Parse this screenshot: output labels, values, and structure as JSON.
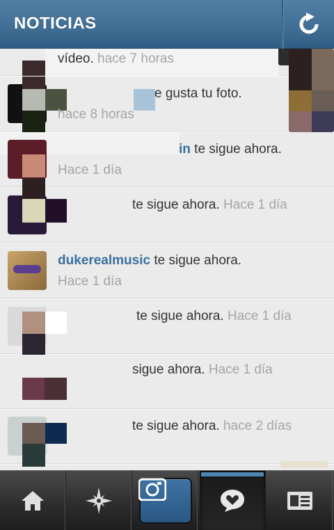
{
  "header": {
    "title": "NOTICIAS",
    "refresh_icon": "refresh-icon"
  },
  "notifications": [
    {
      "user": "",
      "action": "vídeo.",
      "time": "hace 7 horas"
    },
    {
      "user": "",
      "action": "e gusta tu foto.",
      "time": "hace 8 horas"
    },
    {
      "user": "in",
      "action": "te sigue ahora.",
      "time": "Hace 1 día"
    },
    {
      "user": "",
      "action": "te sigue ahora.",
      "time": "Hace 1 día"
    },
    {
      "user": "dukerealmusic",
      "action": "te sigue ahora.",
      "time": "Hace 1 día"
    },
    {
      "user": "",
      "action": "te sigue ahora.",
      "time": "Hace 1 día"
    },
    {
      "user": "",
      "action": "sigue ahora.",
      "time": "Hace 1 día"
    },
    {
      "user": "",
      "action": "te sigue ahora.",
      "time": "hace 2 días"
    }
  ],
  "tabbar": {
    "tabs": [
      {
        "icon": "home-icon"
      },
      {
        "icon": "explore-star-icon"
      },
      {
        "icon": "camera-icon"
      },
      {
        "icon": "news-heart-icon",
        "active": true
      },
      {
        "icon": "profile-card-icon"
      }
    ]
  },
  "colors": {
    "header": "#3f6d94",
    "username": "#3a70a0",
    "timestamp": "#a5a5a5",
    "active_tab_indicator": "#4f86b5"
  }
}
